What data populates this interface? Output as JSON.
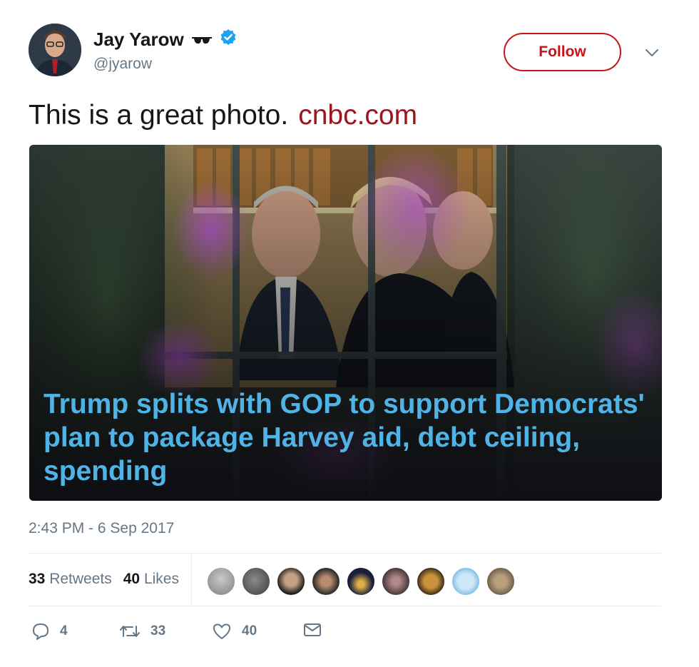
{
  "user": {
    "display_name": "Jay Yarow",
    "handle": "@jyarow",
    "emoji_icon": "sunglasses-icon",
    "verified_icon": "verified-badge-icon"
  },
  "follow_label": "Follow",
  "tweet": {
    "text": "This is a great photo.",
    "link": "cnbc.com"
  },
  "card": {
    "headline": "Trump splits with GOP to support Democrats' plan to package Harvey aid, debt ceiling, spending"
  },
  "timestamp": "2:43 PM - 6 Sep 2017",
  "stats": {
    "retweets_count": "33",
    "retweets_label": "Retweets",
    "likes_count": "40",
    "likes_label": "Likes"
  },
  "actions": {
    "reply_count": "4",
    "retweet_count": "33",
    "like_count": "40"
  },
  "colors": {
    "accent": "#c4161c",
    "headline": "#4fb3e6",
    "muted": "#657786"
  }
}
